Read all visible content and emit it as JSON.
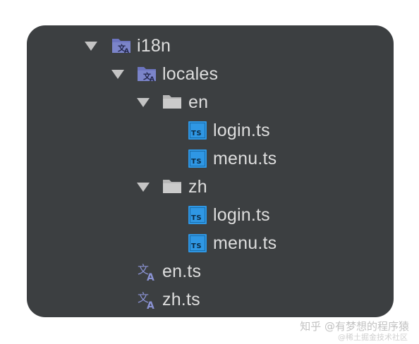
{
  "tree": {
    "i18n": {
      "label": "i18n",
      "icon": "i18n-folder-icon",
      "expanded": true
    },
    "locales": {
      "label": "locales",
      "icon": "i18n-folder-icon",
      "expanded": true
    },
    "en_folder": {
      "label": "en",
      "icon": "folder-icon",
      "expanded": true
    },
    "en_login": {
      "label": "login.ts",
      "icon": "typescript-file-icon"
    },
    "en_menu": {
      "label": "menu.ts",
      "icon": "typescript-file-icon"
    },
    "zh_folder": {
      "label": "zh",
      "icon": "folder-icon",
      "expanded": true
    },
    "zh_login": {
      "label": "login.ts",
      "icon": "typescript-file-icon"
    },
    "zh_menu": {
      "label": "menu.ts",
      "icon": "typescript-file-icon"
    },
    "en_ts": {
      "label": "en.ts",
      "icon": "translation-file-icon"
    },
    "zh_ts": {
      "label": "zh.ts",
      "icon": "translation-file-icon"
    }
  },
  "ts_badge": "TS",
  "watermark": {
    "main": "知乎 @有梦想的程序猿",
    "sub": "@稀土掘金技术社区"
  },
  "colors": {
    "panel": "#3c3f41",
    "text": "#dedede",
    "ts_blue": "#2f97e4",
    "i18n_purple": "#7b84c9",
    "folder_grey": "#c9c9c9"
  }
}
